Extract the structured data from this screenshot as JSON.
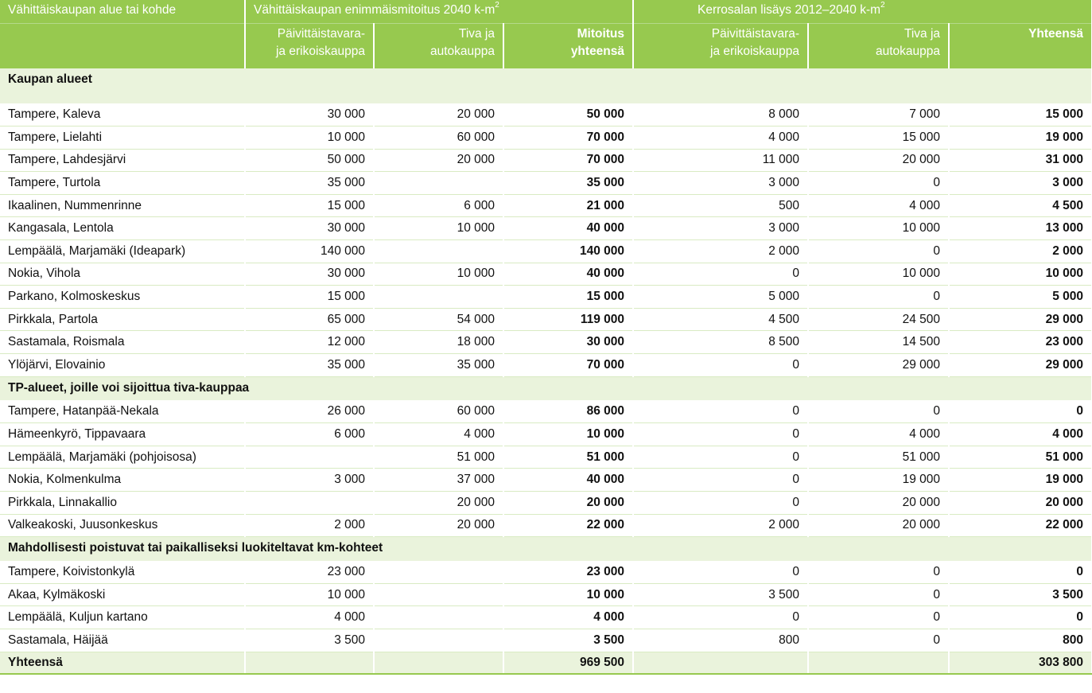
{
  "header": {
    "col_area": "Vähittäiskaupan alue tai kohde",
    "group1": "Vähittäiskaupan enimmäismitoitus 2040 k-m",
    "group1_sup": "2",
    "group2": "Kerrosalan lisäys 2012–2040 k-m",
    "group2_sup": "2",
    "g1_c1_l1": "Päivittäistavara-",
    "g1_c1_l2": "ja erikoiskauppa",
    "g1_c2_l1": "Tiva ja",
    "g1_c2_l2": "autokauppa",
    "g1_c3_l1": "Mitoitus",
    "g1_c3_l2": "yhteensä",
    "g2_c1_l1": "Päivittäistavara-",
    "g2_c1_l2": "ja erikoiskauppa",
    "g2_c2_l1": "Tiva ja",
    "g2_c2_l2": "autokauppa",
    "g2_c3_l1": "Yhteensä"
  },
  "sections": [
    {
      "title": "Kaupan alueet",
      "rows": [
        [
          "Tampere, Kaleva",
          "30 000",
          "20 000",
          "50 000",
          "8 000",
          "7 000",
          "15 000"
        ],
        [
          "Tampere, Lielahti",
          "10 000",
          "60 000",
          "70 000",
          "4 000",
          "15 000",
          "19 000"
        ],
        [
          "Tampere, Lahdesjärvi",
          "50 000",
          "20 000",
          "70 000",
          "11 000",
          "20 000",
          "31 000"
        ],
        [
          "Tampere, Turtola",
          "35 000",
          "",
          "35 000",
          "3 000",
          "0",
          "3 000"
        ],
        [
          "Ikaalinen, Nummenrinne",
          "15 000",
          "6 000",
          "21 000",
          "500",
          "4 000",
          "4 500"
        ],
        [
          "Kangasala, Lentola",
          "30 000",
          "10 000",
          "40 000",
          "3 000",
          "10 000",
          "13 000"
        ],
        [
          "Lempäälä, Marjamäki (Ideapark)",
          "140 000",
          "",
          "140 000",
          "2 000",
          "0",
          "2 000"
        ],
        [
          "Nokia, Vihola",
          "30 000",
          "10 000",
          "40 000",
          "0",
          "10 000",
          "10 000"
        ],
        [
          "Parkano, Kolmoskeskus",
          "15 000",
          "",
          "15 000",
          "5 000",
          "0",
          "5 000"
        ],
        [
          "Pirkkala, Partola",
          "65 000",
          "54 000",
          "119 000",
          "4 500",
          "24 500",
          "29 000"
        ],
        [
          "Sastamala, Roismala",
          "12 000",
          "18 000",
          "30 000",
          "8 500",
          "14 500",
          "23 000"
        ],
        [
          "Ylöjärvi, Elovainio",
          "35 000",
          "35 000",
          "70 000",
          "0",
          "29 000",
          "29 000"
        ]
      ]
    },
    {
      "title": "TP-alueet, joille voi sijoittua tiva-kauppaa",
      "rows": [
        [
          "Tampere, Hatanpää-Nekala",
          "26 000",
          "60 000",
          "86 000",
          "0",
          "0",
          "0"
        ],
        [
          "Hämeenkyrö, Tippavaara",
          "6 000",
          "4 000",
          "10 000",
          "0",
          "4 000",
          "4 000"
        ],
        [
          "Lempäälä, Marjamäki (pohjoisosa)",
          "",
          "51 000",
          "51 000",
          "0",
          "51 000",
          "51 000"
        ],
        [
          "Nokia, Kolmenkulma",
          "3 000",
          "37 000",
          "40 000",
          "0",
          "19 000",
          "19 000"
        ],
        [
          "Pirkkala, Linnakallio",
          "",
          "20 000",
          "20 000",
          "0",
          "20 000",
          "20 000"
        ],
        [
          "Valkeakoski, Juusonkeskus",
          "2 000",
          "20 000",
          "22 000",
          "2 000",
          "20 000",
          "22 000"
        ]
      ]
    },
    {
      "title": "Mahdollisesti poistuvat tai paikalliseksi luokiteltavat km-kohteet",
      "rows": [
        [
          "Tampere, Koivistonkylä",
          "23 000",
          "",
          "23 000",
          "0",
          "0",
          "0"
        ],
        [
          "Akaa, Kylmäkoski",
          "10 000",
          "",
          "10 000",
          "3 500",
          "0",
          "3 500"
        ],
        [
          "Lempäälä, Kuljun kartano",
          "4 000",
          "",
          "4 000",
          "0",
          "0",
          "0"
        ],
        [
          "Sastamala, Häijää",
          "3 500",
          "",
          "3 500",
          "800",
          "0",
          "800"
        ]
      ]
    }
  ],
  "total": [
    "Yhteensä",
    "",
    "",
    "969 500",
    "",
    "",
    "303 800"
  ]
}
